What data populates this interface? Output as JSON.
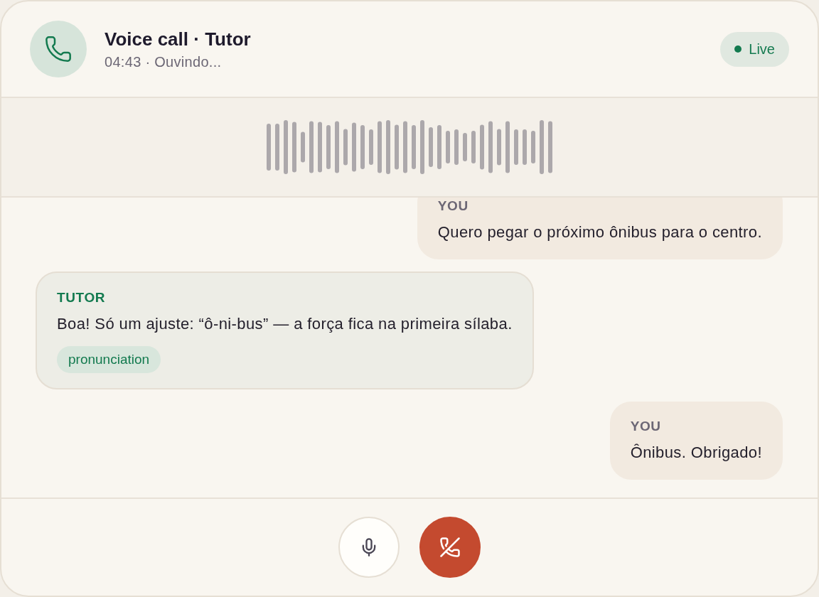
{
  "header": {
    "title": "Voice call · Tutor",
    "subtitle": "04:43 · Ouvindo...",
    "status": "Live"
  },
  "messages": [
    {
      "kind": "user",
      "speaker": "YOU",
      "text": "Quero pegar o próximo ônibus para o centro."
    },
    {
      "kind": "tutor",
      "speaker": "TUTOR",
      "text": "Boa! Só um ajuste: “ô-ni-bus” — a força fica na primeira sílaba.",
      "tags": [
        "pronunciation"
      ]
    },
    {
      "kind": "user",
      "speaker": "YOU",
      "text": "Ônibus. Obrigado!"
    }
  ],
  "controls": {
    "mic": {
      "muted": false
    }
  }
}
